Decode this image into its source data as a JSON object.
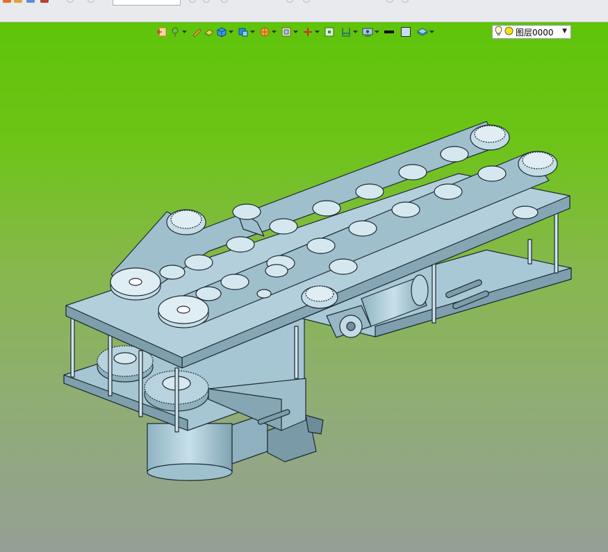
{
  "layer": {
    "name": "图层0000",
    "bulb_icon": "lightbulb-icon",
    "color_icon": "yellow-circle-icon"
  },
  "toolbar": {
    "icons": [
      "export-icon",
      "point-icon",
      "pencil-icon",
      "eraser-icon",
      "cube-icon",
      "render-mode-icon",
      "section-icon",
      "view-frame-icon",
      "axis-icon",
      "fit-view-icon",
      "dimension-icon",
      "display-settings-icon",
      "line-color-icon",
      "fill-color-icon",
      "layer-stack-icon"
    ]
  },
  "colors": {
    "background_top": "#5fc40a",
    "background_bottom": "#959f96",
    "part": "#a9c9d6",
    "edge": "#1b2a33"
  }
}
